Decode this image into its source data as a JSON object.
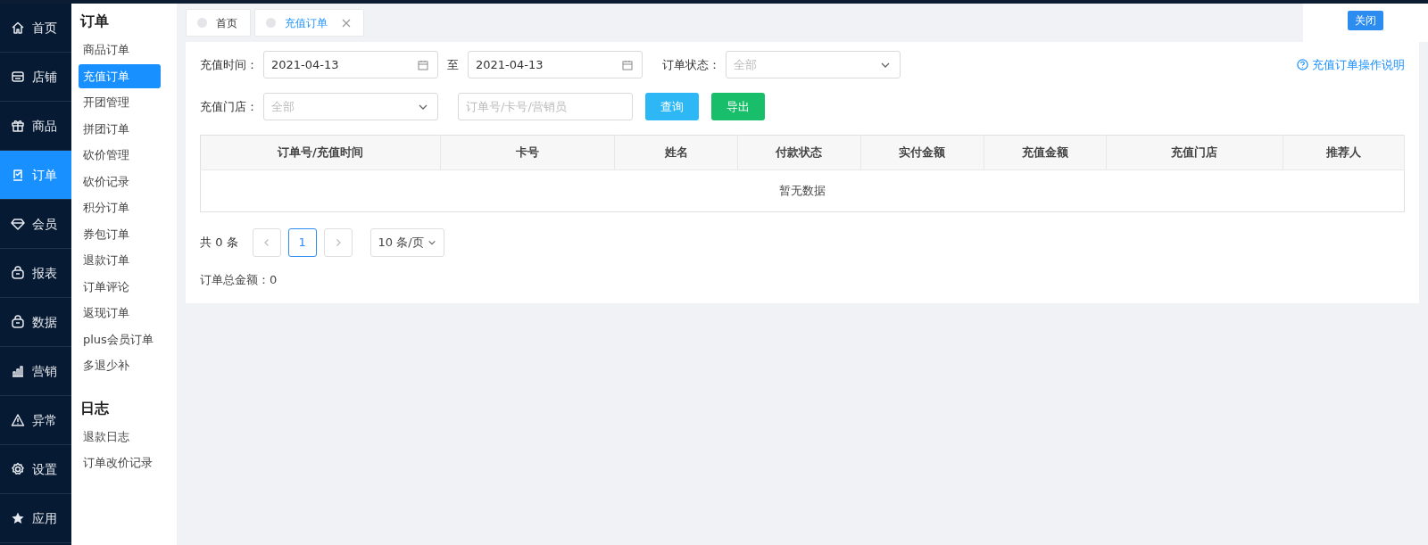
{
  "nav": [
    {
      "label": "首页",
      "selected": false
    },
    {
      "label": "店铺",
      "selected": false
    },
    {
      "label": "商品",
      "selected": false
    },
    {
      "label": "订单",
      "selected": true
    },
    {
      "label": "会员",
      "selected": false
    },
    {
      "label": "报表",
      "selected": false
    },
    {
      "label": "数据",
      "selected": false
    },
    {
      "label": "营销",
      "selected": false
    },
    {
      "label": "异常",
      "selected": false
    },
    {
      "label": "设置",
      "selected": false
    },
    {
      "label": "应用",
      "selected": false
    }
  ],
  "submenu": [
    {
      "heading": "订单",
      "items": [
        {
          "label": "商品订单",
          "selected": false
        },
        {
          "label": "充值订单",
          "selected": true
        },
        {
          "label": "开团管理",
          "selected": false
        },
        {
          "label": "拼团订单",
          "selected": false
        },
        {
          "label": "砍价管理",
          "selected": false
        },
        {
          "label": "砍价记录",
          "selected": false
        },
        {
          "label": "积分订单",
          "selected": false
        },
        {
          "label": "券包订单",
          "selected": false
        },
        {
          "label": "退款订单",
          "selected": false
        },
        {
          "label": "订单评论",
          "selected": false
        },
        {
          "label": "返现订单",
          "selected": false
        },
        {
          "label": "plus会员订单",
          "selected": false
        },
        {
          "label": "多退少补",
          "selected": false
        }
      ]
    },
    {
      "heading": "日志",
      "items": [
        {
          "label": "退款日志",
          "selected": false
        },
        {
          "label": "订单改价记录",
          "selected": false
        }
      ]
    }
  ],
  "tabs": [
    {
      "label": "首页",
      "selected": false,
      "closable": false
    },
    {
      "label": "充值订单",
      "selected": true,
      "closable": true
    }
  ],
  "close_button": "关闭",
  "filters": {
    "time_label": "充值时间：",
    "date_from": "2021-04-13",
    "to_label": "至",
    "date_to": "2021-04-13",
    "status_label": "订单状态：",
    "status_placeholder": "全部",
    "help_link": "充值订单操作说明",
    "store_label": "充值门店：",
    "store_placeholder": "全部",
    "search_placeholder": "订单号/卡号/营销员",
    "query_button": "查询",
    "export_button": "导出"
  },
  "table": {
    "columns": [
      "订单号/充值时间",
      "卡号",
      "姓名",
      "付款状态",
      "实付金额",
      "充值金额",
      "充值门店",
      "推荐人"
    ],
    "empty_text": "暂无数据"
  },
  "pagination": {
    "total": "共 0 条",
    "pages": [
      {
        "label": "1",
        "selected": true
      }
    ],
    "page_size": "10 条/页"
  },
  "summary": "订单总金额：0"
}
